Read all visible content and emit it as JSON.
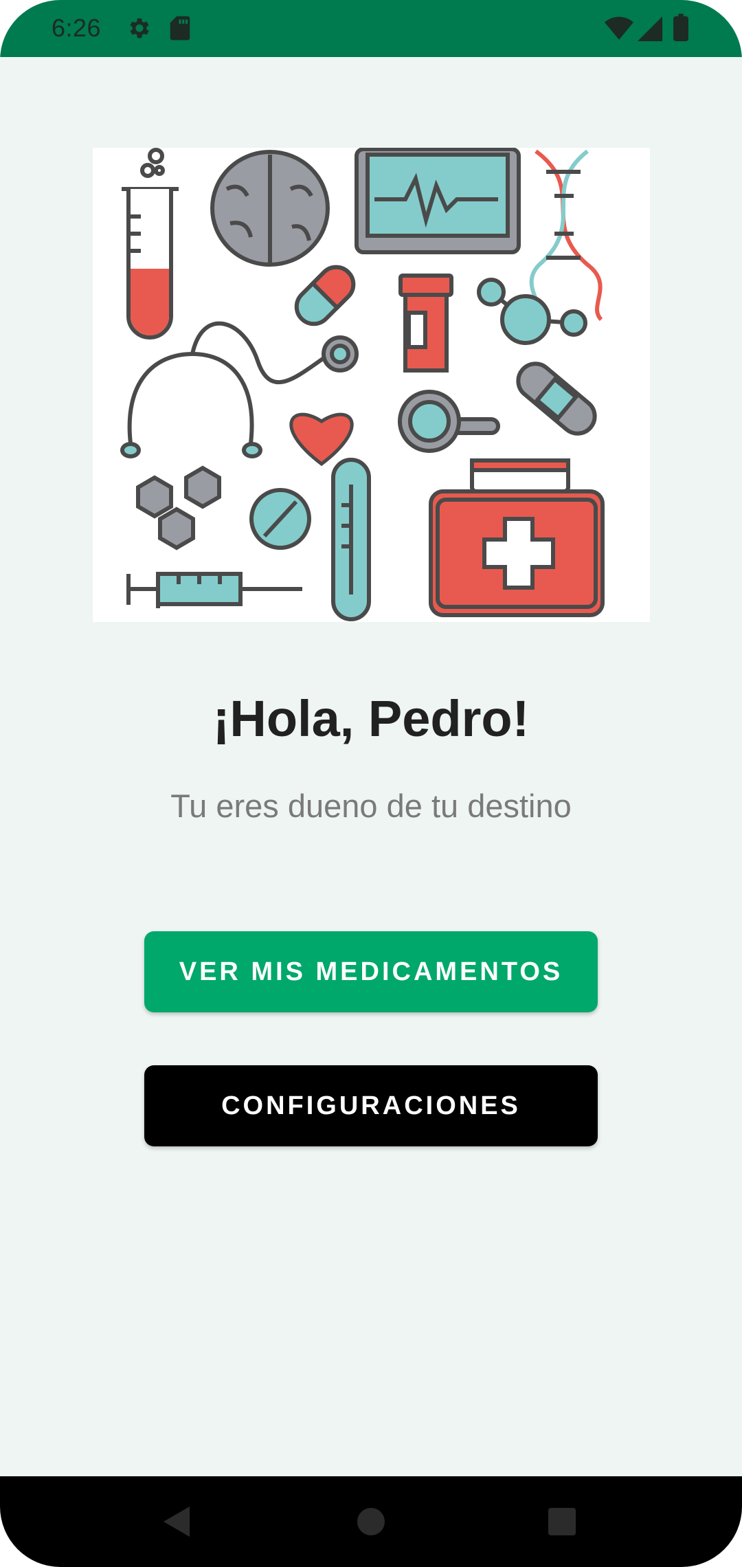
{
  "status_bar": {
    "time": "6:26",
    "background_color": "#007a4f",
    "left_icons": [
      "settings-gear-icon",
      "sd-card-icon"
    ],
    "right_icons": [
      "wifi-icon",
      "cellular-signal-icon",
      "battery-icon"
    ]
  },
  "main": {
    "illustration_icon": "medical-icons-illustration",
    "greeting": "¡Hola, Pedro!",
    "subtitle": "Tu eres dueno de tu destino",
    "primary_button_label": "VER MIS MEDICAMENTOS",
    "secondary_button_label": "CONFIGURACIONES"
  },
  "colors": {
    "background": "#eef5f3",
    "primary_button": "#00a86b",
    "secondary_button": "#000000",
    "greeting_text": "#212121",
    "subtitle_text": "#7a7a7a"
  },
  "nav_bar": {
    "icons": [
      "back-icon",
      "home-icon",
      "recents-icon"
    ]
  }
}
